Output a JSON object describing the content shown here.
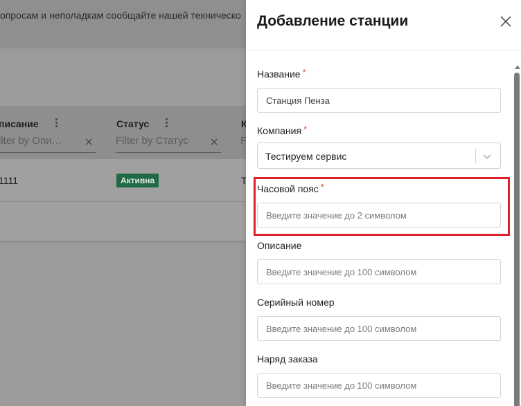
{
  "background": {
    "notice_text": "опросам и неполадкам сообщайте нашей техническо",
    "table": {
      "columns": [
        {
          "title": "писание",
          "filter_placeholder": "ilter by Опи…"
        },
        {
          "title": "Статус",
          "filter_placeholder": "Filter by Статус"
        },
        {
          "title": "К",
          "filter_placeholder": "F"
        }
      ],
      "row": {
        "description": "1111",
        "status": "Активна",
        "third": "Т"
      }
    }
  },
  "drawer": {
    "title": "Добавление станции",
    "fields": {
      "name": {
        "label": "Название",
        "required": "*",
        "value": "Станция Пенза"
      },
      "company": {
        "label": "Компания",
        "required": "*",
        "value": "Тестируем сервис"
      },
      "timezone": {
        "label": "Часовой пояс",
        "required": "*",
        "placeholder": "Введите значение до 2 символом"
      },
      "description": {
        "label": "Описание",
        "placeholder": "Введите значение до 100 символом"
      },
      "serial": {
        "label": "Серийный номер",
        "placeholder": "Введите значение до 100 символом"
      },
      "order": {
        "label": "Наряд заказа",
        "placeholder": "Введите значение до 100 символом"
      }
    }
  },
  "colors": {
    "required": "#e0443c",
    "highlight": "#e0202b",
    "badge": "#1f6a44"
  },
  "icons": {
    "close": "close-icon",
    "chevron": "chevron-down-icon",
    "column_menu": "kebab-menu-icon",
    "clear_filter": "clear-icon"
  }
}
